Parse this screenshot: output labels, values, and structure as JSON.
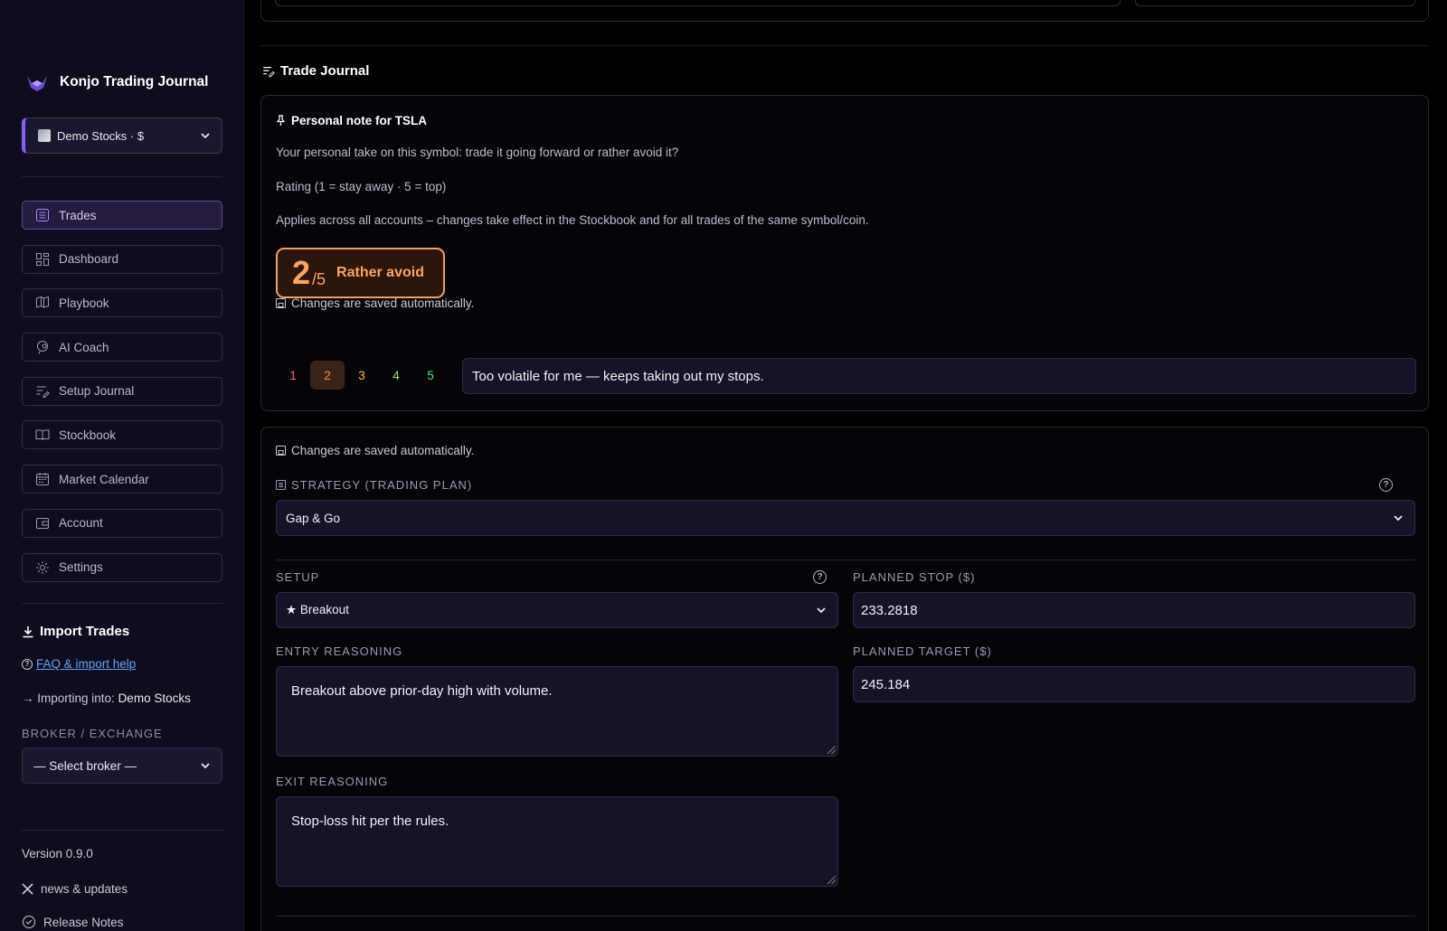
{
  "sidebar": {
    "brand": "Konjo Trading Journal",
    "account_select": "Demo Stocks · $",
    "nav": [
      {
        "label": "Trades",
        "icon": "list-icon",
        "active": true
      },
      {
        "label": "Dashboard",
        "icon": "dashboard-icon",
        "active": false
      },
      {
        "label": "Playbook",
        "icon": "playbook-icon",
        "active": false
      },
      {
        "label": "AI Coach",
        "icon": "brain-icon",
        "active": false
      },
      {
        "label": "Setup Journal",
        "icon": "journal-icon",
        "active": false
      },
      {
        "label": "Stockbook",
        "icon": "book-icon",
        "active": false
      },
      {
        "label": "Market Calendar",
        "icon": "calendar-icon",
        "active": false
      },
      {
        "label": "Account",
        "icon": "wallet-icon",
        "active": false
      },
      {
        "label": "Settings",
        "icon": "gear-icon",
        "active": false
      }
    ],
    "import_title": "Import Trades",
    "faq_link": "FAQ & import help",
    "importing_prefix": "Importing into: ",
    "importing_target": "Demo Stocks",
    "broker_label": "BROKER / EXCHANGE",
    "broker_select": "— Select broker —",
    "version": "Version 0.9.0",
    "news": "news & updates",
    "release_notes": "Release Notes"
  },
  "journal": {
    "title": "Trade Journal",
    "note": {
      "title": "Personal note for TSLA",
      "question": "Your personal take on this symbol: trade it going forward or rather avoid it?",
      "rating_hint": "Rating (1 = stay away · 5 = top)",
      "scope": "Applies across all accounts – changes take effect in the Stockbook and for all trades of the same symbol/coin.",
      "rating_value": "2",
      "rating_max": "/5",
      "rating_label": "Rather avoid",
      "saved": "Changes are saved automatically.",
      "rating_options": [
        {
          "label": "1",
          "color": "#f87171"
        },
        {
          "label": "2",
          "color": "#fb923c"
        },
        {
          "label": "3",
          "color": "#fbbf24"
        },
        {
          "label": "4",
          "color": "#a3e635"
        },
        {
          "label": "5",
          "color": "#4ade80"
        }
      ],
      "selected_rating": 2,
      "note_text": "Too volatile for me — keeps taking out my stops."
    },
    "plan": {
      "saved": "Changes are saved automatically.",
      "strategy_label": "STRATEGY (TRADING PLAN)",
      "strategy_value": "Gap & Go",
      "setup_label": "SETUP",
      "setup_value": "★ Breakout",
      "planned_stop_label": "PLANNED STOP ($)",
      "planned_stop_value": "233.2818",
      "planned_target_label": "PLANNED TARGET ($)",
      "planned_target_value": "245.184",
      "entry_label": "ENTRY REASONING",
      "entry_value": "Breakout above prior-day high with volume.",
      "exit_label": "EXIT REASONING",
      "exit_value": "Stop-loss hit per the rules."
    }
  },
  "colors": {
    "accent": "#8b5cf6",
    "rating_orange": "#ffa35c",
    "link": "#60a5fa"
  }
}
